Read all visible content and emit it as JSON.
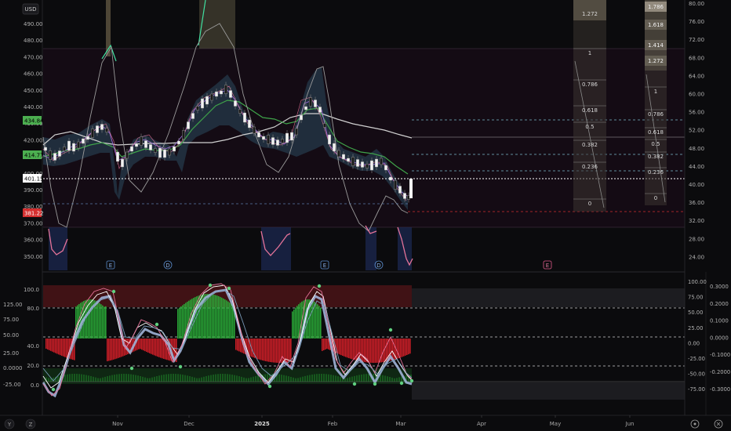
{
  "currency_label": "USD",
  "top_pane": {
    "left_axis_ticks": [
      "490.00",
      "480.00",
      "470.00",
      "460.00",
      "450.00",
      "440.00",
      "430.00",
      "420.00",
      "410.00",
      "400.00",
      "390.00",
      "380.00",
      "370.00",
      "360.00",
      "350.00"
    ],
    "right_axis_ticks": [
      "80.00",
      "76.00",
      "72.00",
      "68.00",
      "64.00",
      "60.00",
      "56.00",
      "52.00",
      "48.00",
      "44.00",
      "40.00",
      "36.00",
      "32.00",
      "28.00",
      "24.00"
    ],
    "price_tags": [
      {
        "text": "434.84",
        "color": "#4caf50",
        "text_color": "#000000"
      },
      {
        "text": "414.77",
        "color": "#4caf50",
        "text_color": "#000000"
      },
      {
        "text": "401.15",
        "color": "#ffffff",
        "text_color": "#000000"
      },
      {
        "text": "381.22",
        "color": "#d32f2f",
        "text_color": "#ffffff"
      }
    ],
    "event_markers": [
      {
        "text": "E",
        "type": "earnings"
      },
      {
        "text": "D",
        "type": "dividend"
      },
      {
        "text": "E",
        "type": "earnings"
      },
      {
        "text": "D",
        "type": "dividend"
      },
      {
        "text": "E",
        "type": "earnings-upcoming"
      }
    ],
    "fib_box_a": {
      "top_label": "1.272",
      "levels": [
        "1",
        "0.786",
        "0.618",
        "0.5",
        "0.382",
        "0.236",
        "0"
      ]
    },
    "fib_box_b": {
      "top_labels": [
        "1.786",
        "1.618",
        "1.414",
        "1.272"
      ],
      "levels": [
        "1",
        "0.786",
        "0.618",
        "0.5",
        "0.382",
        "0.236",
        "0"
      ]
    }
  },
  "bottom_pane": {
    "left_axis_ticks": [
      "125.00",
      "100.0",
      "80.0",
      "75.00",
      "50.00",
      "40.0",
      "25.00",
      "20.0",
      "0.0000",
      "-25.00",
      "0.0"
    ],
    "right_axis_a_ticks": [
      "100.00",
      "75.00",
      "50.00",
      "25.00",
      "0.00",
      "-25.00",
      "-50.00",
      "-75.00"
    ],
    "right_axis_b_ticks": [
      "0.3000",
      "0.2000",
      "0.1000",
      "0.0000",
      "-0.1000",
      "-0.2000",
      "-0.3000"
    ]
  },
  "time_axis": {
    "labels": [
      "Nov",
      "Dec",
      "2025",
      "Feb",
      "Mar",
      "Apr",
      "May",
      "Jun"
    ]
  },
  "corner_icons": [
    "Y",
    "Z"
  ],
  "colors": {
    "background": "#0b0b0d",
    "up_candle": "#f2f2f2",
    "down_candle": "#2a2a2a",
    "green": "#4caf50",
    "red": "#e53935",
    "pink": "#e57399",
    "gray_line": "#b8b8b8",
    "blue_band": "#243a4a",
    "overbought": "#4a1418",
    "oversold": "#0f2a14"
  }
}
